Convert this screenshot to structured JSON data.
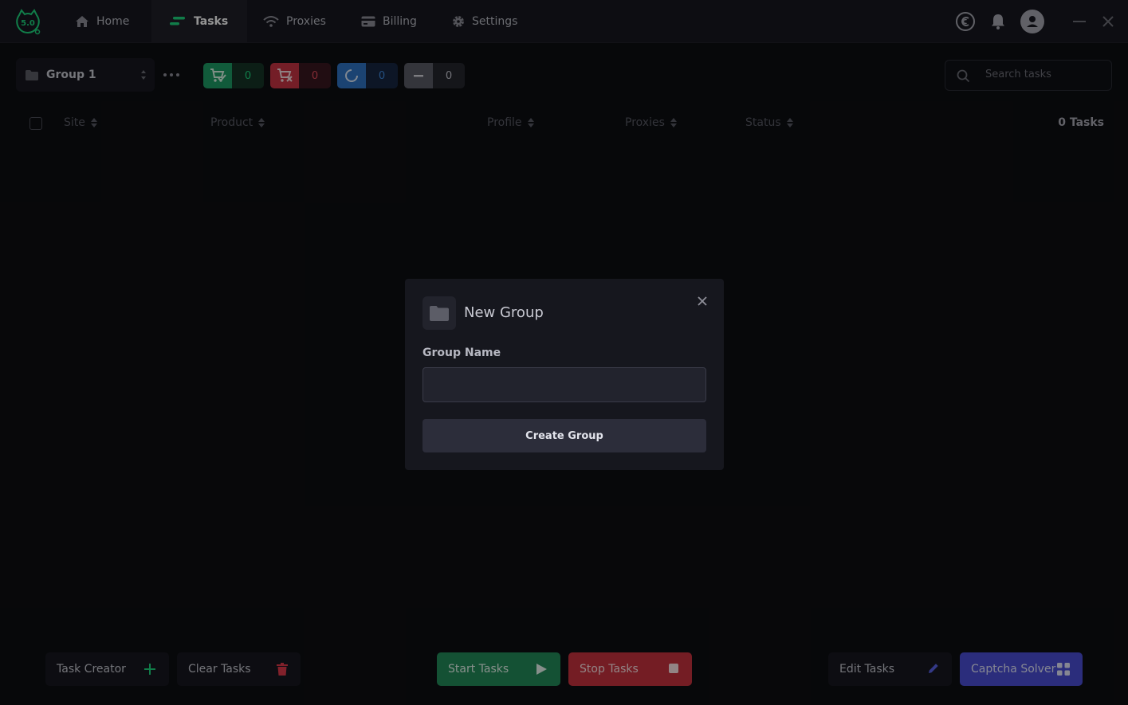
{
  "app": {
    "logo_text": "5.0"
  },
  "nav": {
    "home": "Home",
    "tasks": "Tasks",
    "proxies": "Proxies",
    "billing": "Billing",
    "settings": "Settings"
  },
  "toolbar": {
    "group_name": "Group 1",
    "counters": [
      {
        "kind": "success",
        "value": "0",
        "color": "#1e9e66"
      },
      {
        "kind": "failed",
        "value": "0",
        "color": "#c93544"
      },
      {
        "kind": "running",
        "value": "0",
        "color": "#2f74c4"
      },
      {
        "kind": "idle",
        "value": "0",
        "color": "#5b5c66"
      }
    ],
    "search_placeholder": "Search tasks"
  },
  "table": {
    "columns": [
      "Site",
      "Product",
      "Profile",
      "Proxies",
      "Status"
    ],
    "task_count": "0 Tasks",
    "rows": []
  },
  "bottom": {
    "task_creator": "Task Creator",
    "clear_tasks": "Clear Tasks",
    "start_tasks": "Start Tasks",
    "stop_tasks": "Stop Tasks",
    "edit_tasks": "Edit Tasks",
    "captcha_solver": "Captcha Solver"
  },
  "modal": {
    "title": "New Group",
    "field_label": "Group Name",
    "field_value": "",
    "submit_label": "Create Group"
  },
  "colors": {
    "accent": "#1ed67f",
    "start": "#238c5b",
    "stop": "#c8333f",
    "captcha": "#4a4fd6"
  }
}
